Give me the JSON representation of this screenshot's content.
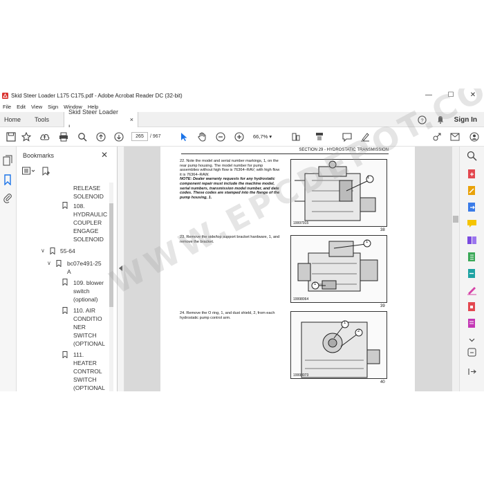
{
  "window": {
    "title": "Skid Steer Loader L175 C175.pdf - Adobe Acrobat Reader DC (32-bit)",
    "minimize": "—",
    "maximize": "☐",
    "close": "✕"
  },
  "menu": [
    "File",
    "Edit",
    "View",
    "Sign",
    "Window",
    "Help"
  ],
  "tabs": {
    "home": "Home",
    "tools": "Tools",
    "document": "Skid Steer Loader L...",
    "document_close": "×",
    "help": "?",
    "signin": "Sign In"
  },
  "toolbar": {
    "page_current": "265",
    "page_total": "/ 967",
    "zoom": "66,7%",
    "zoom_caret": "▾"
  },
  "bookmarks": {
    "title": "Bookmarks",
    "close": "✕",
    "items": [
      {
        "label": "RELEASE"
      },
      {
        "label": "SOLENOID"
      },
      {
        "label": "108."
      },
      {
        "label": "HYDRAULIC"
      },
      {
        "label": "COUPLER"
      },
      {
        "label": "ENGAGE"
      },
      {
        "label": "SOLENOID"
      },
      {
        "label": "55-64"
      },
      {
        "label": "bc07e491-25"
      },
      {
        "label": "A"
      },
      {
        "label": "109. blower"
      },
      {
        "label": "switch"
      },
      {
        "label": "(optional)"
      },
      {
        "label": "110. AIR"
      },
      {
        "label": "CONDITIO"
      },
      {
        "label": "NER"
      },
      {
        "label": "SWITCH"
      },
      {
        "label": "(OPTIONAL"
      },
      {
        "label": "111."
      },
      {
        "label": "HEATER"
      },
      {
        "label": "CONTROL"
      },
      {
        "label": "SWITCH"
      },
      {
        "label": "(OPTIONAL"
      }
    ],
    "toggles": [
      "∨",
      "∨"
    ]
  },
  "document": {
    "section_header": "SECTION 29 - HYDROSTATIC TRANSMISSION",
    "steps": [
      {
        "text": "22. Note the model and serial number markings, 1, on the rear pump housing. The model number for pump assemblies without high flow is 76364–RAV; with high flow it is 76364–RAW.",
        "note": "NOTE: Dealer warranty requests for any hydrostatic component repair must include the machine model, serial numbers, transmission model number, and date codes. These codes are stamped into the flange of the pump housing, 1."
      },
      {
        "text": "23. Remove the side/top support bracket hardware, 1, and remove the bracket.",
        "note": ""
      },
      {
        "text": "24. Remove the O ring, 1, and dust shield, 2, from each hydrostatic pump control arm.",
        "note": ""
      }
    ],
    "figures": [
      {
        "caption": "19997915",
        "number": "38",
        "callouts": [
          "1"
        ]
      },
      {
        "caption": "19998064",
        "number": "39",
        "callouts": [
          "1",
          "1"
        ]
      },
      {
        "caption": "19998073",
        "number": "40",
        "callouts": [
          "1",
          "2"
        ]
      }
    ]
  },
  "watermark": "WWW.EPCDEPOT.COM",
  "colors": {
    "accent": "#1a73e8",
    "red": "#d9302c",
    "tabbar": "#f0f0f0",
    "document_bg": "#d9d9d9"
  }
}
